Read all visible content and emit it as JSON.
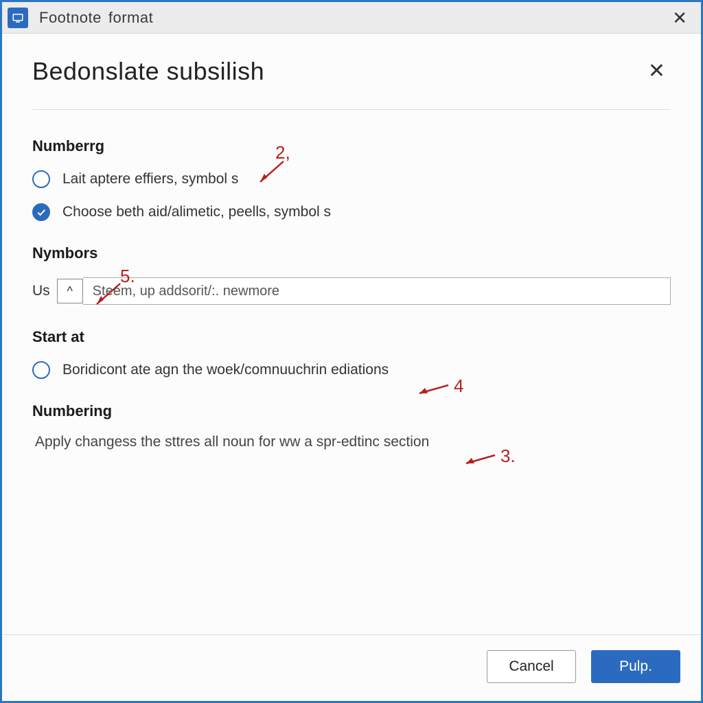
{
  "window": {
    "title_word1": "Footnote",
    "title_word2": "format"
  },
  "dialog": {
    "heading": "Bedonslate subsilish"
  },
  "sections": {
    "numberrg": {
      "label": "Numberrg",
      "option1": {
        "text": "Lait aptere effiers, symbol s",
        "checked": false
      },
      "option2": {
        "text": "Choose beth aid/alimetic, peells, symbol s",
        "checked": true
      }
    },
    "nymbors": {
      "label": "Nymbors",
      "us_label": "Us",
      "stepper_glyph": "^",
      "combo_text": "Steem, up addsorit/:. newmore"
    },
    "start_at": {
      "label": "Start at",
      "option1": {
        "text": "Boridicont ate agn the woek/comnuuchrin ediations",
        "checked": false
      }
    },
    "numbering": {
      "label": "Numbering",
      "desc": "Apply changess the sttres all noun for ww a spr-edtinc section"
    }
  },
  "annotations": {
    "a2": "2,",
    "a5": "5.",
    "a4": "4",
    "a3": "3."
  },
  "footer": {
    "cancel": "Cancel",
    "primary": "Pulp."
  }
}
